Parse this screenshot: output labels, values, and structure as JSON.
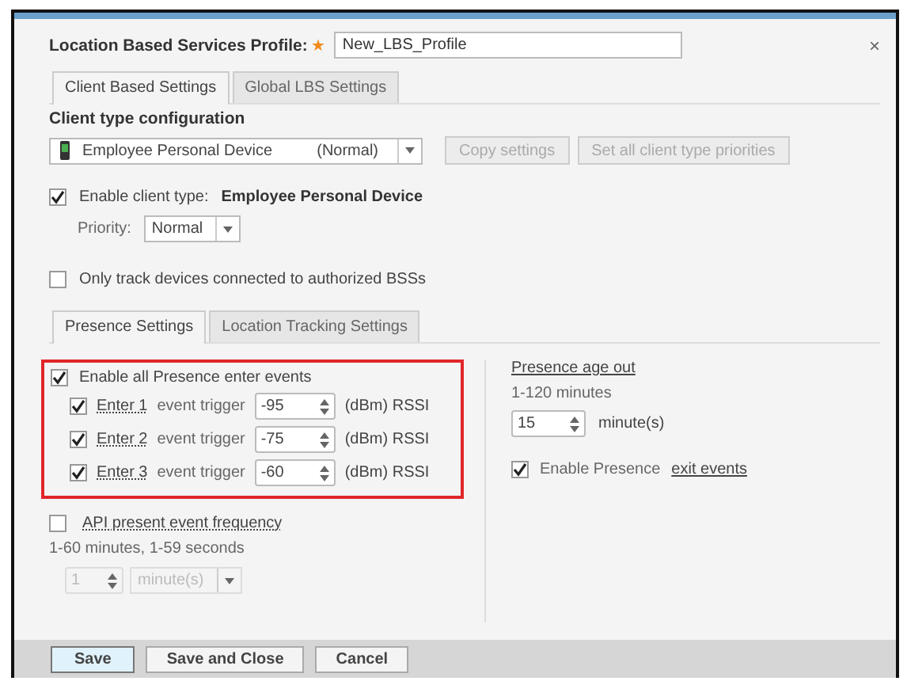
{
  "profile": {
    "label": "Location Based Services Profile:",
    "required_mark": "★",
    "value": "New_LBS_Profile",
    "close": "×"
  },
  "tabs": [
    {
      "label": "Client Based Settings",
      "selected": true
    },
    {
      "label": "Global LBS Settings",
      "selected": false
    }
  ],
  "client_type_configuration": {
    "heading": "Client type configuration",
    "dropdown": {
      "value": "Employee Personal Device",
      "priority": "(Normal)"
    },
    "buttons": [
      {
        "label": "Copy settings",
        "disabled": true
      },
      {
        "label": "Set all client type priorities",
        "disabled": true
      }
    ]
  },
  "enable_client_type": {
    "checked": true,
    "label": "Enable client type:",
    "value": "Employee Personal Device"
  },
  "priority": {
    "label": "Priority:",
    "value": "Normal"
  },
  "only_track": {
    "checked": false,
    "label": "Only track devices connected to authorized BSSs"
  },
  "sub_tabs": [
    {
      "label": "Presence Settings",
      "selected": true
    },
    {
      "label": "Location Tracking Settings",
      "selected": false
    }
  ],
  "presence_enter": {
    "checked": true,
    "label": "Enable all Presence enter events",
    "triggers": [
      {
        "checked": true,
        "name": "Enter 1",
        "label": "event trigger",
        "value": "-95",
        "unit": "(dBm) RSSI"
      },
      {
        "checked": true,
        "name": "Enter 2",
        "label": "event trigger",
        "value": "-75",
        "unit": "(dBm) RSSI"
      },
      {
        "checked": true,
        "name": "Enter 3",
        "label": "event trigger",
        "value": "-60",
        "unit": "(dBm) RSSI"
      }
    ]
  },
  "api_frequency": {
    "checked": false,
    "label": "API present event frequency",
    "hint": "1-60 minutes, 1-59 seconds",
    "value": "1",
    "unit": "minute(s)",
    "disabled": true
  },
  "presence_age_out": {
    "label": "Presence age out",
    "hint": "1-120 minutes",
    "value": "15",
    "unit": "minute(s)"
  },
  "exit_events": {
    "checked": true,
    "label": "Enable Presence",
    "link": "exit events"
  },
  "footer_buttons": [
    {
      "label": "Save",
      "primary": true
    },
    {
      "label": "Save and Close",
      "primary": false
    },
    {
      "label": "Cancel",
      "primary": false
    }
  ]
}
